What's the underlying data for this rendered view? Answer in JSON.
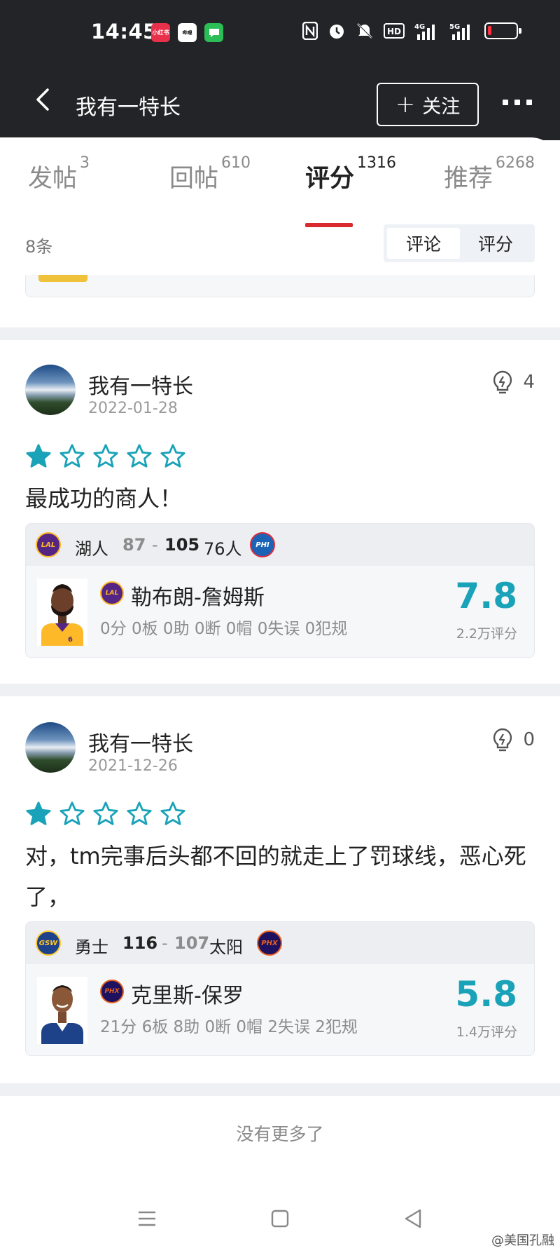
{
  "status_bar": {
    "time": "14:45",
    "notif_icons": [
      "小红书",
      "哔哩",
      "消息"
    ],
    "status_icons": [
      "nfc-icon",
      "alarm-icon",
      "mute-icon",
      "HD",
      "4G",
      "5G"
    ],
    "battery_level": 0.12
  },
  "header": {
    "title": "我有一特长",
    "follow_label": "关注",
    "follow_icon": "plus-icon"
  },
  "tabs": [
    {
      "label": "发帖",
      "count": "3"
    },
    {
      "label": "回帖",
      "count": "610"
    },
    {
      "label": "评分",
      "count": "1316",
      "active": true
    },
    {
      "label": "推荐",
      "count": "6268"
    }
  ],
  "list": {
    "count_label": "8条",
    "segment": {
      "comment": "评论",
      "rating": "评分",
      "selected": "评论"
    }
  },
  "posts": [
    {
      "user": "我有一特长",
      "date": "2022-01-28",
      "likes": "4",
      "stars": 1,
      "stars_max": 5,
      "text": "最成功的商人！",
      "game": {
        "home_logo": "LAL",
        "home_team": "湖人",
        "home_score": "87",
        "away_score": "105",
        "away_team": "76人",
        "away_logo": "PHI",
        "player_logo": "LAL",
        "player_name": "勒布朗-詹姆斯",
        "player_stats": "0分 0板 0助 0断 0帽 0失误 0犯规",
        "rating": "7.8",
        "rating_count": "2.2万评分"
      }
    },
    {
      "user": "我有一特长",
      "date": "2021-12-26",
      "likes": "0",
      "stars": 1,
      "stars_max": 5,
      "text": "对，tm完事后头都不回的就走上了罚球线，恶心死了，",
      "game": {
        "home_logo": "GSW",
        "home_team": "勇士",
        "home_score": "116",
        "away_score": "107",
        "away_team": "太阳",
        "away_logo": "PHX",
        "player_logo": "PHX",
        "player_name": "克里斯-保罗",
        "player_stats": "21分 6板 8助 0断 0帽 2失误 2犯规",
        "rating": "5.8",
        "rating_count": "1.4万评分"
      }
    }
  ],
  "footer": {
    "no_more": "没有更多了"
  },
  "watermark": "@美国孔融",
  "colors": {
    "accent_red": "#d92a2f",
    "star_teal": "#1aa3b8",
    "header_bg": "#232427"
  }
}
